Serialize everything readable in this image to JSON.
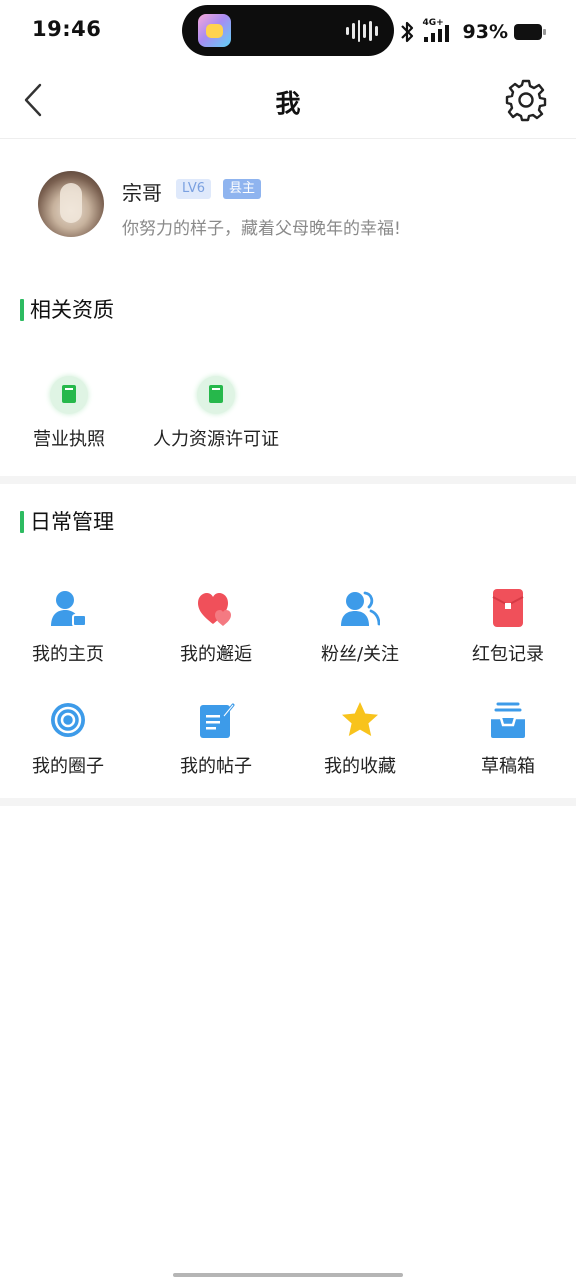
{
  "status_bar": {
    "time": "19:46",
    "network": "4G+",
    "battery": "93%",
    "icons": [
      "dynamic-island-app-icon",
      "audio-wave-icon",
      "bluetooth-icon",
      "signal-icon",
      "battery-icon"
    ]
  },
  "nav": {
    "title": "我",
    "icons": [
      "chevron-left-icon",
      "gear-icon"
    ]
  },
  "profile": {
    "name": "宗哥",
    "level": "LV6",
    "role": "县主",
    "bio": "你努力的样子，藏着父母晚年的幸福!"
  },
  "qualifications": {
    "title": "相关资质",
    "items": [
      {
        "label": "营业执照",
        "icon": "book-icon"
      },
      {
        "label": "人力资源许可证",
        "icon": "book-icon"
      }
    ]
  },
  "daily": {
    "title": "日常管理",
    "items": [
      {
        "label": "我的主页",
        "icon": "user-home-icon"
      },
      {
        "label": "我的邂逅",
        "icon": "hearts-icon"
      },
      {
        "label": "粉丝/关注",
        "icon": "followers-icon"
      },
      {
        "label": "红包记录",
        "icon": "red-envelope-icon"
      },
      {
        "label": "我的圈子",
        "icon": "circle-target-icon"
      },
      {
        "label": "我的帖子",
        "icon": "note-edit-icon"
      },
      {
        "label": "我的收藏",
        "icon": "star-icon"
      },
      {
        "label": "草稿箱",
        "icon": "inbox-icon"
      }
    ]
  },
  "colors": {
    "accent_green": "#2dbb61",
    "icon_blue": "#3d9be9",
    "icon_red": "#f0505a",
    "star_yellow": "#f8c31c",
    "badge_blue": "#8fb4ef"
  }
}
